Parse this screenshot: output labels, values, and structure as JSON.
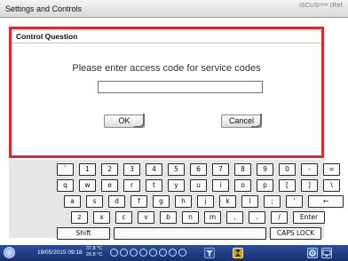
{
  "window": {
    "title": "Settings and Controls",
    "brand": "iSCUSᵉˡᵒʷ (Ref."
  },
  "dialog": {
    "heading": "Control Question",
    "prompt": "Please enter access code for service codes",
    "code_value": "",
    "ok_label": "OK",
    "cancel_label": "Cancel"
  },
  "keyboard": {
    "row1": [
      "`",
      "1",
      "2",
      "3",
      "4",
      "5",
      "6",
      "7",
      "8",
      "9",
      "0",
      "-",
      "="
    ],
    "row2": [
      "q",
      "w",
      "e",
      "r",
      "t",
      "y",
      "u",
      "i",
      "o",
      "p",
      "[",
      "]",
      "\\"
    ],
    "row3": [
      "a",
      "s",
      "d",
      "f",
      "g",
      "h",
      "j",
      "k",
      "l",
      ";",
      "'",
      "←"
    ],
    "row4": [
      "z",
      "x",
      "c",
      "v",
      "b",
      "n",
      "m",
      ",",
      ".",
      "/",
      "Enter"
    ],
    "shift_label": "Shift",
    "caps_label": "CAPS LOCK"
  },
  "taskbar": {
    "datetime": "19/05/2015 09:18",
    "temp1": "37.8 °C",
    "temp2": "29.8 °C",
    "icons": [
      "power-icon",
      "filter-icon",
      "hourglass-icon",
      "gear-icon",
      "monitor-icon"
    ]
  }
}
